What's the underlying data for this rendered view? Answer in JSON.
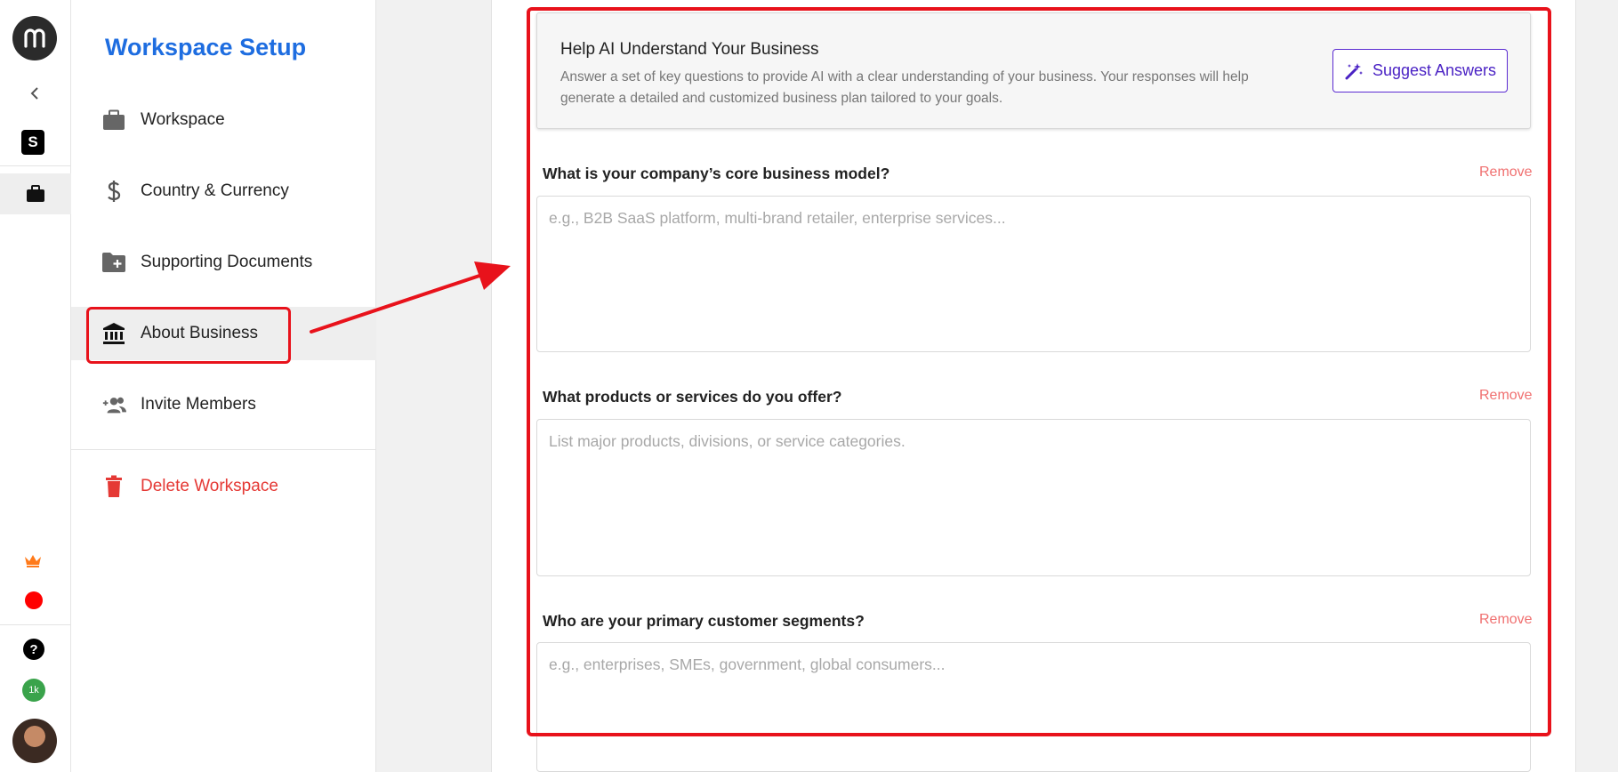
{
  "rail": {
    "logo_icon": "brand-logo-icon",
    "workspace_initial": "S",
    "notification_count": "1k",
    "colors": {
      "record": "#ff0000",
      "count_badge": "#3aa34b",
      "crown": "#ff7a1a"
    }
  },
  "sidebar": {
    "title": "Workspace Setup",
    "items": [
      {
        "label": "Workspace",
        "icon": "briefcase-icon"
      },
      {
        "label": "Country & Currency",
        "icon": "dollar-icon"
      },
      {
        "label": "Supporting Documents",
        "icon": "folder-add-icon"
      },
      {
        "label": "About Business",
        "icon": "bank-icon",
        "active": true
      },
      {
        "label": "Invite Members",
        "icon": "group-add-icon"
      }
    ],
    "delete_label": "Delete Workspace",
    "colors": {
      "title": "#1e6de0",
      "delete": "#e53935"
    }
  },
  "main": {
    "card": {
      "title": "Help AI Understand Your Business",
      "description": "Answer a set of key questions to provide AI with a clear understanding of your business. Your responses will help generate a detailed and customized business plan tailored to your goals.",
      "suggest_label": "Suggest Answers"
    },
    "questions": [
      {
        "label": "What is your company’s core business model?",
        "placeholder": "e.g., B2B SaaS platform, multi-brand retailer, enterprise services...",
        "remove": "Remove"
      },
      {
        "label": "What products or services do you offer?",
        "placeholder": "List major products, divisions, or service categories.",
        "remove": "Remove"
      },
      {
        "label": "Who are your primary customer segments?",
        "placeholder": "e.g., enterprises, SMEs, government, global consumers...",
        "remove": "Remove"
      }
    ],
    "colors": {
      "accent": "#4a22c4",
      "remove": "#f07070",
      "annotation": "#e8121b"
    }
  }
}
